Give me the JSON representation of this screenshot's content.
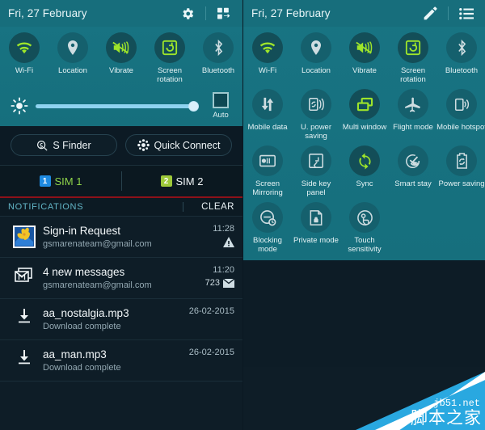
{
  "colors": {
    "teal": "#18717f",
    "teal_dark": "#15606d",
    "accent_green": "#9ee52a",
    "dark": "#0e1d27",
    "red_line": "#8e1119",
    "watermark_blue": "#29a8e0"
  },
  "left_panel": {
    "statusbar": {
      "date": "Fri, 27 February",
      "icons": [
        {
          "name": "gear-icon"
        },
        {
          "name": "grid-arrange-icon"
        }
      ]
    },
    "toggles": [
      {
        "label": "Wi-Fi",
        "icon": "wifi-icon",
        "active": true
      },
      {
        "label": "Location",
        "icon": "location-pin-icon",
        "active": false
      },
      {
        "label": "Vibrate",
        "icon": "vibrate-icon",
        "active": true
      },
      {
        "label": "Screen rotation",
        "icon": "screen-rotation-icon",
        "active": true
      },
      {
        "label": "Bluetooth",
        "icon": "bluetooth-icon",
        "active": false
      }
    ],
    "brightness": {
      "icon": "brightness-icon",
      "value": 94,
      "auto_label": "Auto",
      "auto_checked": false
    },
    "quick_buttons": [
      {
        "label": "S Finder",
        "icon": "s-finder-icon"
      },
      {
        "label": "Quick Connect",
        "icon": "quick-connect-icon"
      }
    ],
    "sims": [
      {
        "badge": "1",
        "label": "SIM 1",
        "badge_color": "#1e8ae0",
        "text_color": "#8fd44a"
      },
      {
        "badge": "2",
        "label": "SIM 2",
        "badge_color": "#9ec93a",
        "text_color": "#f2f7f9"
      }
    ],
    "notifications_header": {
      "title": "NOTIFICATIONS",
      "clear_label": "CLEAR"
    },
    "notifications": [
      {
        "icon": "photo-flower-icon",
        "title": "Sign-in Request",
        "subtitle": "gsmarenateam@gmail.com",
        "time": "11:28",
        "extra": "",
        "extra_icon": "warning-triangle-icon"
      },
      {
        "icon": "gmail-stack-icon",
        "title": "4 new messages",
        "subtitle": "gsmarenateam@gmail.com",
        "time": "11:20",
        "extra": "723",
        "extra_icon": "envelope-icon"
      },
      {
        "icon": "download-icon",
        "title": "aa_nostalgia.mp3",
        "subtitle": "Download complete",
        "time": "26-02-2015",
        "extra": "",
        "extra_icon": ""
      },
      {
        "icon": "download-icon",
        "title": "aa_man.mp3",
        "subtitle": "Download complete",
        "time": "26-02-2015",
        "extra": "",
        "extra_icon": ""
      }
    ]
  },
  "right_panel": {
    "statusbar": {
      "date": "Fri, 27 February",
      "icons": [
        {
          "name": "edit-pencil-icon"
        },
        {
          "name": "list-icon"
        }
      ]
    },
    "toggles": [
      {
        "label": "Wi-Fi",
        "icon": "wifi-icon",
        "active": true
      },
      {
        "label": "Location",
        "icon": "location-pin-icon",
        "active": false
      },
      {
        "label": "Vibrate",
        "icon": "vibrate-icon",
        "active": true
      },
      {
        "label": "Screen rotation",
        "icon": "screen-rotation-icon",
        "active": true
      },
      {
        "label": "Bluetooth",
        "icon": "bluetooth-icon",
        "active": false
      },
      {
        "label": "Mobile data",
        "icon": "mobile-data-icon",
        "active": false
      },
      {
        "label": "U. power saving",
        "icon": "ultra-power-saving-icon",
        "active": false
      },
      {
        "label": "Multi window",
        "icon": "multi-window-icon",
        "active": true
      },
      {
        "label": "Flight mode",
        "icon": "airplane-icon",
        "active": false
      },
      {
        "label": "Mobile hotspot",
        "icon": "mobile-hotspot-icon",
        "active": false
      },
      {
        "label": "Screen Mirroring",
        "icon": "screen-mirroring-icon",
        "active": false
      },
      {
        "label": "Side key panel",
        "icon": "side-key-panel-icon",
        "active": false
      },
      {
        "label": "Sync",
        "icon": "sync-icon",
        "active": true
      },
      {
        "label": "Smart stay",
        "icon": "smart-stay-icon",
        "active": false
      },
      {
        "label": "Power saving",
        "icon": "power-saving-icon",
        "active": false
      },
      {
        "label": "Blocking mode",
        "icon": "blocking-mode-icon",
        "active": false
      },
      {
        "label": "Private mode",
        "icon": "private-mode-icon",
        "active": false
      },
      {
        "label": "Touch sensitivity",
        "icon": "touch-sensitivity-icon",
        "active": false
      }
    ]
  },
  "watermark": {
    "line1": "jb51.net",
    "line2": "脚本之家"
  }
}
